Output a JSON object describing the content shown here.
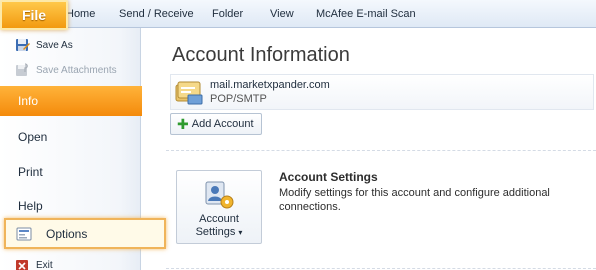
{
  "ribbon": {
    "file_tab": "File",
    "tabs": [
      {
        "label": "Home"
      },
      {
        "label": "Send / Receive"
      },
      {
        "label": "Folder"
      },
      {
        "label": "View"
      },
      {
        "label": "McAfee E-mail Scan"
      }
    ]
  },
  "backstage": {
    "commands": [
      {
        "label": "Save As",
        "icon": "save-as-icon",
        "enabled": true
      },
      {
        "label": "Save Attachments",
        "icon": "save-attachments-icon",
        "enabled": false
      }
    ],
    "items": [
      {
        "label": "Info",
        "active": true
      },
      {
        "label": "Open"
      },
      {
        "label": "Print"
      },
      {
        "label": "Help"
      }
    ],
    "options": {
      "label": "Options",
      "icon": "options-icon",
      "highlighted": true
    },
    "exit": {
      "label": "Exit",
      "icon": "exit-icon"
    }
  },
  "main": {
    "title": "Account Information",
    "account": {
      "email": "mail.marketxpander.com",
      "type": "POP/SMTP",
      "icon": "mailbox-icon"
    },
    "add_account_label": "Add Account",
    "account_settings": {
      "button_line1": "Account",
      "button_line2": "Settings",
      "title": "Account Settings",
      "description": "Modify settings for this account and configure additional connections."
    }
  },
  "colors": {
    "accent": "#f59a12",
    "ribbon": "#dfe9f5",
    "selection": "#fffae8"
  }
}
